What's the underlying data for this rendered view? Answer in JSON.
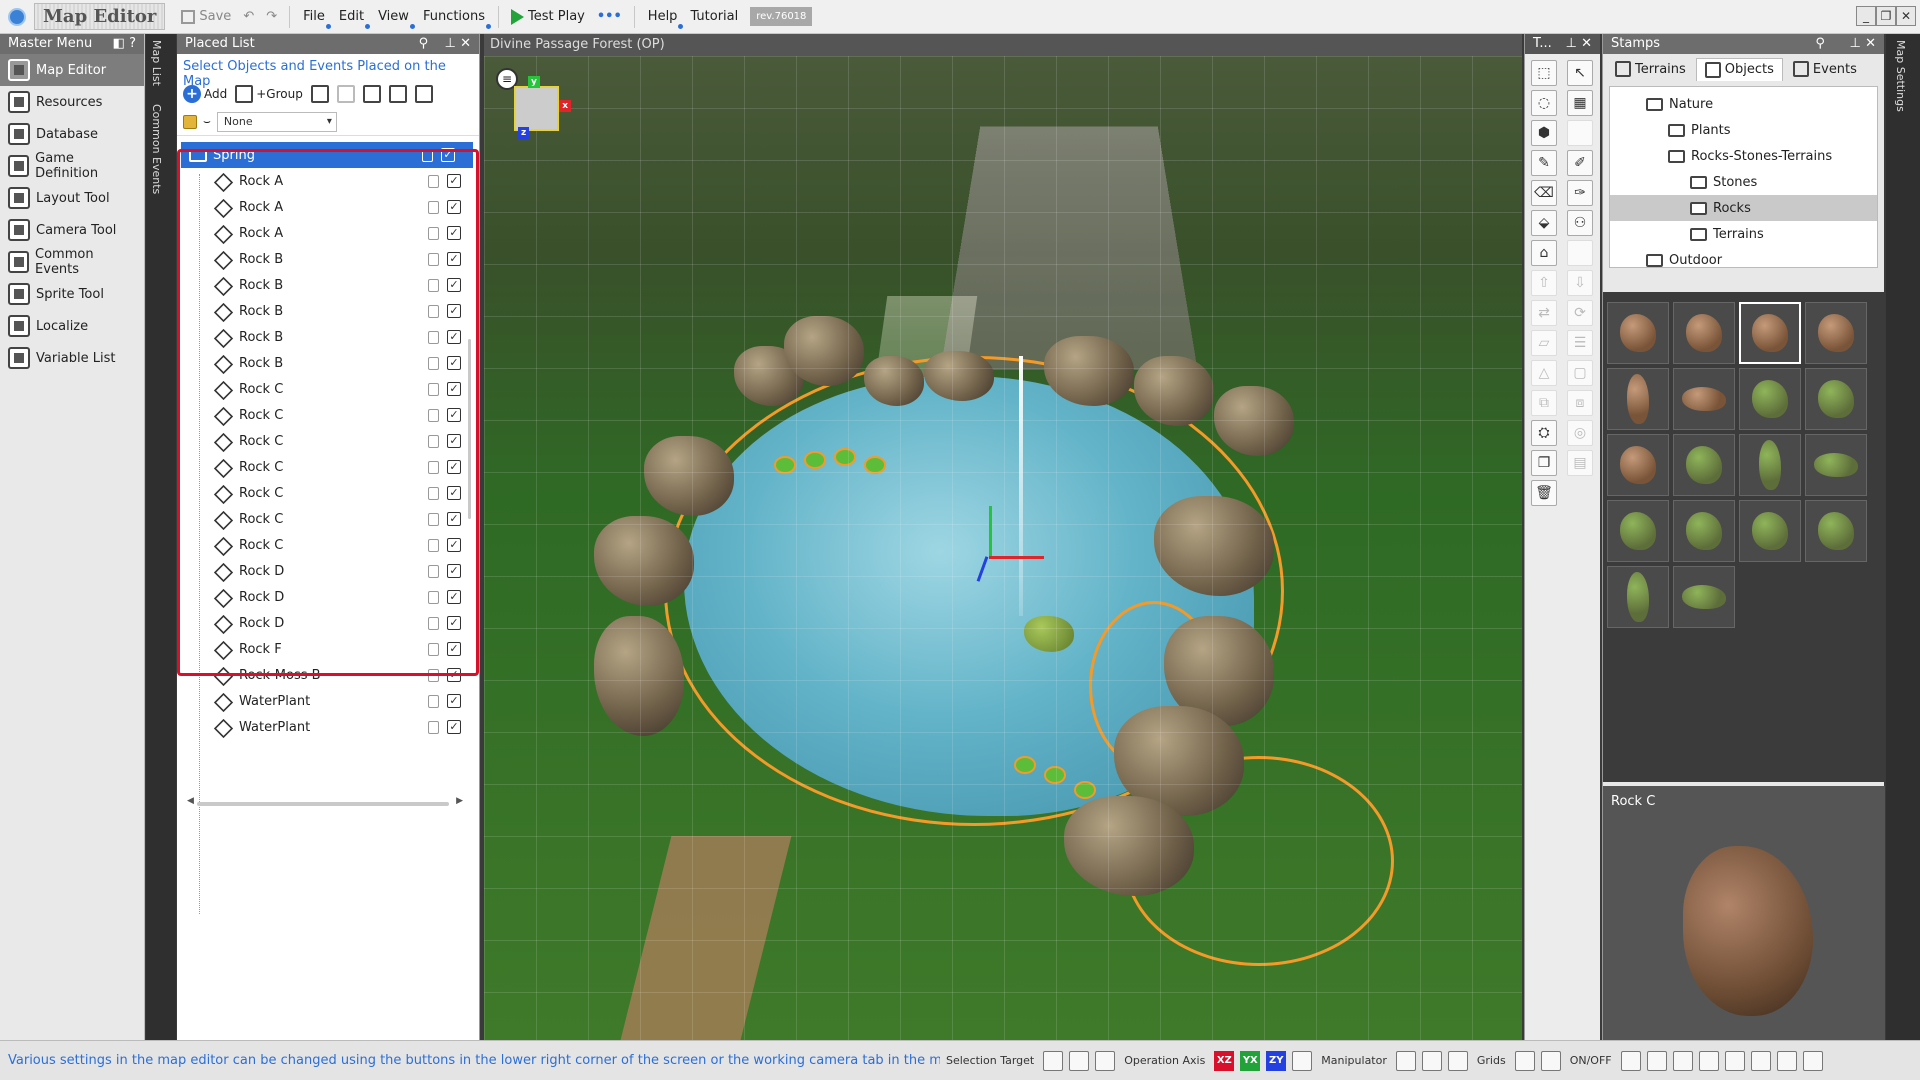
{
  "app": {
    "title": "Map Editor",
    "save_label": "Save",
    "menus": [
      "File",
      "Edit",
      "View",
      "Functions"
    ],
    "test_play_label": "Test Play",
    "more_label": "•••",
    "help_label": "Help",
    "tutorial_label": "Tutorial",
    "revision": "rev.76018"
  },
  "master_menu": {
    "title": "Master Menu",
    "items": [
      {
        "label": "Map Editor",
        "icon": "map-editor-icon",
        "active": true
      },
      {
        "label": "Resources",
        "icon": "resources-icon"
      },
      {
        "label": "Database",
        "icon": "database-icon"
      },
      {
        "label": "Game Definition",
        "icon": "game-definition-icon"
      },
      {
        "label": "Layout Tool",
        "icon": "layout-tool-icon"
      },
      {
        "label": "Camera Tool",
        "icon": "camera-tool-icon"
      },
      {
        "label": "Common Events",
        "icon": "common-events-icon"
      },
      {
        "label": "Sprite Tool",
        "icon": "sprite-tool-icon"
      },
      {
        "label": "Localize",
        "icon": "localize-icon"
      },
      {
        "label": "Variable List",
        "icon": "variable-list-icon"
      }
    ]
  },
  "side_tabs": [
    "Map List",
    "Common Events"
  ],
  "placed_list": {
    "title": "Placed List",
    "hint": "Select Objects and Events Placed on the Map",
    "add_label": "Add",
    "group_label": "+Group",
    "filter_value": "None",
    "folder": "Spring",
    "items": [
      "Rock A",
      "Rock A",
      "Rock A",
      "Rock B",
      "Rock B",
      "Rock B",
      "Rock B",
      "Rock B",
      "Rock C",
      "Rock C",
      "Rock C",
      "Rock C",
      "Rock C",
      "Rock C",
      "Rock C",
      "Rock D",
      "Rock D",
      "Rock D",
      "Rock F",
      "Rock-Moss B",
      "WaterPlant",
      "WaterPlant"
    ]
  },
  "viewport": {
    "title": "Divine Passage Forest (OP)",
    "axis_labels": {
      "x": "x",
      "y": "y",
      "z": "z"
    }
  },
  "tools_panel": {
    "title": "T..."
  },
  "stamps": {
    "title": "Stamps",
    "tabs": [
      {
        "label": "Terrains",
        "icon": "terrain-icon"
      },
      {
        "label": "Objects",
        "icon": "objects-icon",
        "active": true
      },
      {
        "label": "Events",
        "icon": "events-icon"
      }
    ],
    "tree": [
      {
        "label": "Nature",
        "level": 0
      },
      {
        "label": "Plants",
        "level": 1
      },
      {
        "label": "Rocks-Stones-Terrains",
        "level": 1
      },
      {
        "label": "Stones",
        "level": 2
      },
      {
        "label": "Rocks",
        "level": 2,
        "selected": true
      },
      {
        "label": "Terrains",
        "level": 2
      },
      {
        "label": "Outdoor",
        "level": 0
      }
    ],
    "preview_label": "Rock C"
  },
  "right_tab": "Map Settings",
  "status": {
    "message": "Various settings in the map editor can be changed using the buttons in the lower right corner of the screen or the working camera tab in the map se",
    "selection_target": "Selection Target",
    "operation_axis": "Operation Axis",
    "axes": [
      "XZ",
      "YX",
      "ZY"
    ],
    "manipulator": "Manipulator",
    "grids": "Grids",
    "onoff": "ON/OFF"
  },
  "colors": {
    "accent": "#2b6fd6",
    "highlight_box": "#d8102c",
    "outline": "#f39a28",
    "axis_xz": "#d8102c",
    "axis_yx": "#22a33a",
    "axis_zy": "#2440e0"
  }
}
